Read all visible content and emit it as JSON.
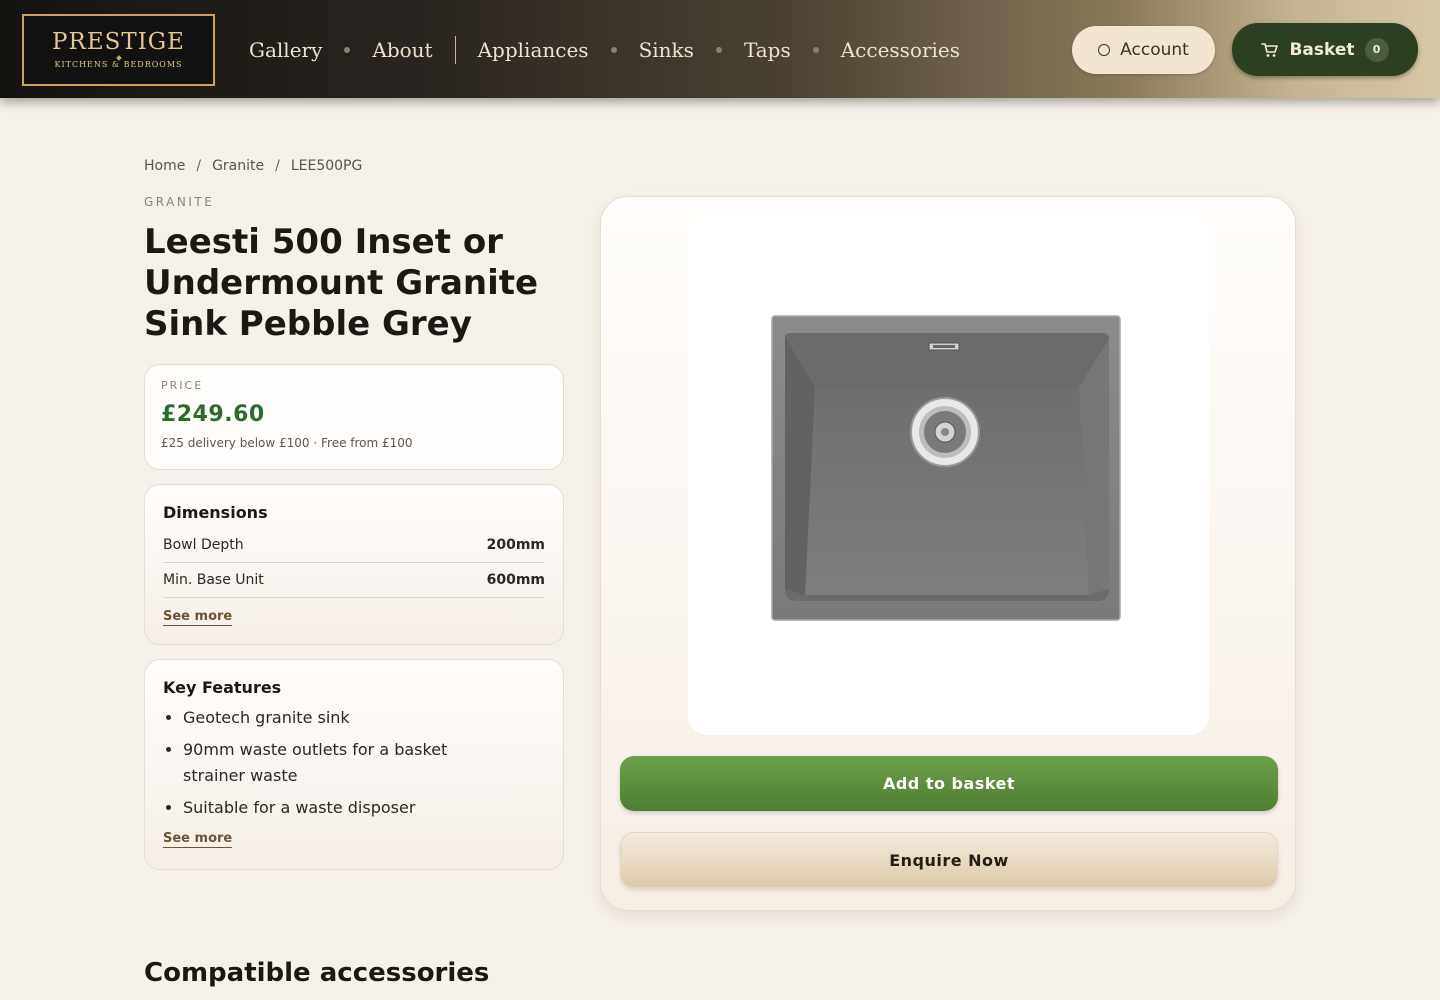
{
  "header": {
    "logo_main": "PRESTIGE",
    "logo_sub": "KITCHENS & BEDROOMS",
    "nav": [
      "Gallery",
      "About",
      "Appliances",
      "Sinks",
      "Taps",
      "Accessories"
    ],
    "account_label": "Account",
    "basket_label": "Basket",
    "basket_count": "0"
  },
  "breadcrumb": [
    "Home",
    "Granite",
    "LEE500PG"
  ],
  "product": {
    "category": "GRANITE",
    "title": "Leesti 500 Inset or Undermount Granite Sink Pebble Grey",
    "price_label": "PRICE",
    "price": "£249.60",
    "delivery_note": "£25 delivery below £100 · Free from £100"
  },
  "dimensions": {
    "title": "Dimensions",
    "rows": [
      {
        "label": "Bowl Depth",
        "value": "200mm"
      },
      {
        "label": "Min. Base Unit",
        "value": "600mm"
      }
    ],
    "see_more": "See more"
  },
  "features": {
    "title": "Key Features",
    "items": [
      "Geotech granite sink",
      "90mm waste outlets for a basket strainer waste",
      "Suitable for a waste disposer"
    ],
    "see_more": "See more"
  },
  "actions": {
    "add_to_basket": "Add to basket",
    "enquire": "Enquire Now"
  },
  "sections": {
    "compatible_accessories": "Compatible accessories"
  },
  "colors": {
    "accent_green": "#4e7e31",
    "price_green": "#2d6a2d",
    "basket_dark": "#2c3f20",
    "gold": "#c9a35d"
  },
  "icons": [
    "user-icon",
    "cart-icon"
  ]
}
